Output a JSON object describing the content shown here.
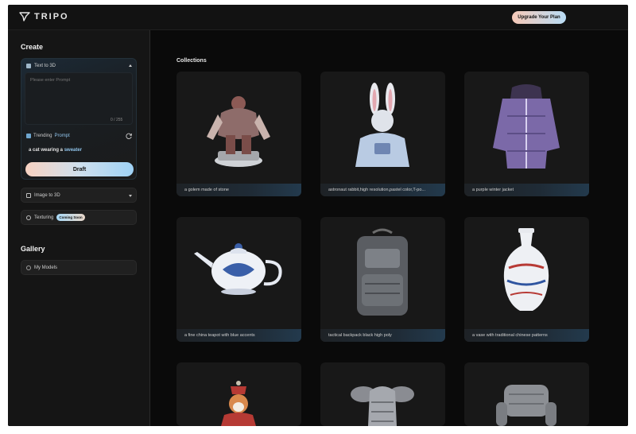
{
  "app": {
    "name": "TRIPO"
  },
  "header": {
    "upgrade_label": "Upgrade Your Plan"
  },
  "sidebar": {
    "create_title": "Create",
    "text_to_3d": {
      "label": "Text to 3D",
      "prompt_placeholder": "Please enter Prompt",
      "char_count": "0 / 255",
      "trending_label": "Trending",
      "trending_highlight": "Prompt",
      "suggestion_prefix": "a cat wearing a",
      "suggestion_highlight": "sweater",
      "draft_label": "Draft"
    },
    "image_to_3d": {
      "label": "Image to 3D"
    },
    "texturing": {
      "label": "Texturing",
      "badge": "Coming Soon"
    },
    "gallery_title": "Gallery",
    "my_models": {
      "label": "My Models"
    }
  },
  "main": {
    "collections_title": "Collections",
    "cards": [
      {
        "caption": "a golem made of stone",
        "icon": "stone-golem"
      },
      {
        "caption": "astronaut rabbit,high resolution,pastel color,T-po...",
        "icon": "astronaut-rabbit"
      },
      {
        "caption": "a purple winter jacket",
        "icon": "purple-jacket"
      },
      {
        "caption": "a fine china teapot with blue accents",
        "icon": "china-teapot"
      },
      {
        "caption": "tactical backpack black high poly",
        "icon": "tactical-backpack"
      },
      {
        "caption": "a vase with traditional chinese patterns",
        "icon": "chinese-vase"
      },
      {
        "caption": "",
        "icon": "shiba-figure"
      },
      {
        "caption": "",
        "icon": "armor-chestplate"
      },
      {
        "caption": "",
        "icon": "leather-armchair"
      }
    ]
  },
  "colors": {
    "accent_blue": "#8fc3ea",
    "accent_peach": "#f6c9b8",
    "background": "#0b0b0b"
  }
}
